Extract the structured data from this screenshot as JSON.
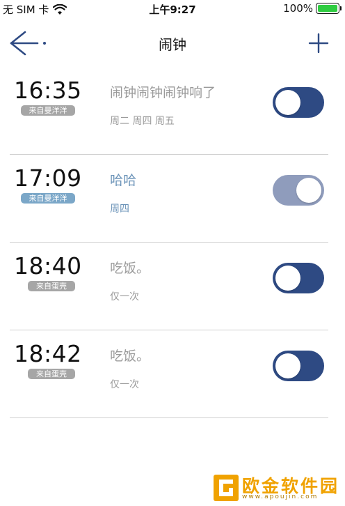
{
  "status_bar": {
    "carrier": "无 SIM 卡",
    "time": "上午9:27",
    "battery_percent": "100%",
    "battery_level": 1.0
  },
  "nav": {
    "title": "闹钟",
    "back_icon": "back-arrow-icon",
    "add_icon": "plus-icon"
  },
  "alarms": [
    {
      "time": "16:35",
      "source": "来自曼洋洋",
      "title": "闹钟闹钟闹钟响了",
      "repeat": "周二 周四 周五",
      "enabled": true,
      "tag_color": "#a6a6a6"
    },
    {
      "time": "17:09",
      "source": "来自曼洋洋",
      "title": "哈哈",
      "repeat": "周四",
      "enabled": false,
      "tag_color": "#7ba7c8"
    },
    {
      "time": "18:40",
      "source": "来自蛋壳",
      "title": "吃饭。",
      "repeat": "仅一次",
      "enabled": true,
      "tag_color": "#a6a6a6"
    },
    {
      "time": "18:42",
      "source": "来自蛋壳",
      "title": "吃饭。",
      "repeat": "仅一次",
      "enabled": true,
      "tag_color": "#a6a6a6"
    }
  ],
  "watermark": {
    "name": "欧金软件园",
    "url": "www.apoujin.com"
  },
  "colors": {
    "toggle_on": "#2e4a83",
    "toggle_off": "#8f9cbc",
    "accent": "#6b93b8"
  }
}
